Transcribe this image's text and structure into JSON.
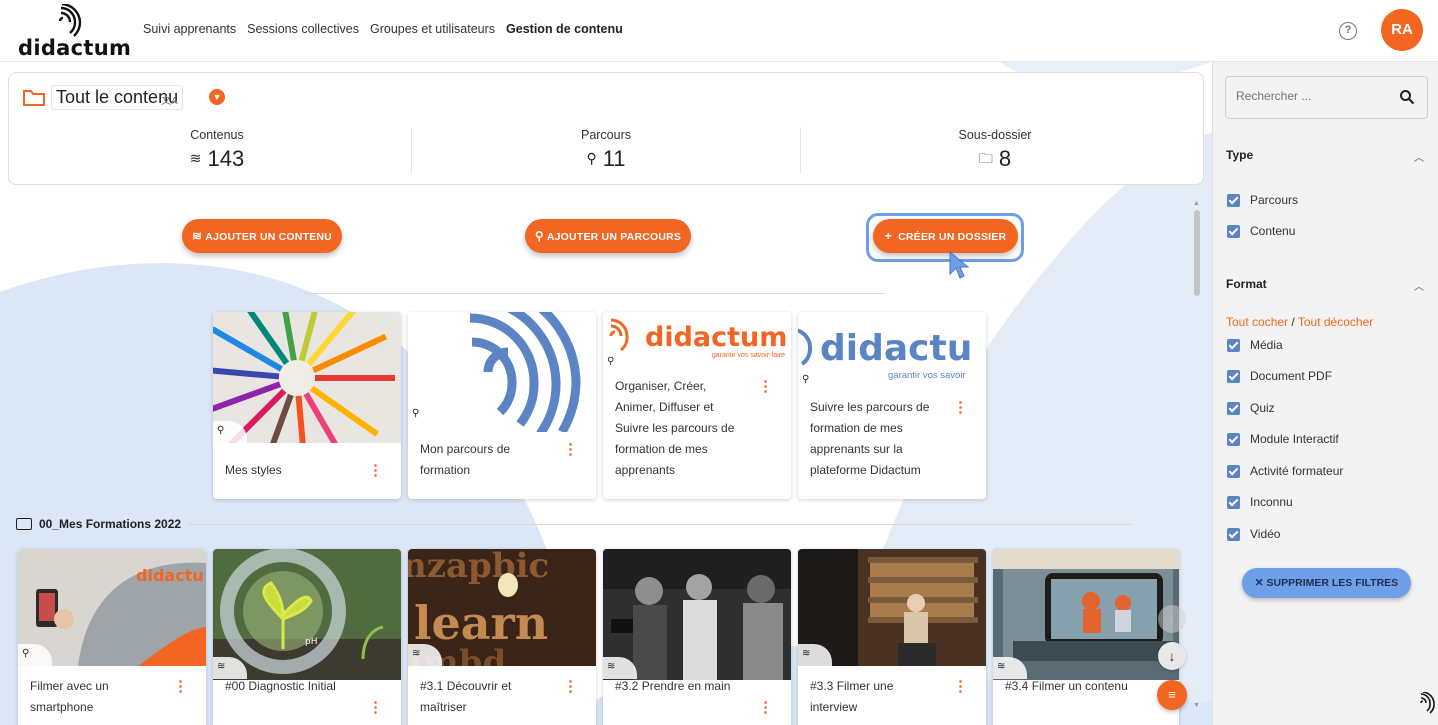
{
  "app": {
    "logo_text": "didactum"
  },
  "nav": {
    "items": [
      "Suivi apprenants",
      "Sessions collectives",
      "Groupes et utilisateurs",
      "Gestion de contenu"
    ],
    "active_index": 3
  },
  "header": {
    "help_icon": "help-circle-icon",
    "avatar_initials": "RA",
    "avatar_color": "#f26522"
  },
  "summary": {
    "title": "Tout le contenu",
    "translate_glyph": "文A",
    "stats": [
      {
        "label": "Contenus",
        "value": "143",
        "icon": "contenus-icon"
      },
      {
        "label": "Parcours",
        "value": "11",
        "icon": "parcours-icon"
      },
      {
        "label": "Sous-dossier",
        "value": "8",
        "icon": "folder-icon"
      }
    ]
  },
  "actions": {
    "add_content": "AJOUTER UN CONTENU",
    "add_path": "AJOUTER UN PARCOURS",
    "create_folder": "CRÉER UN DOSSIER",
    "create_folder_prefix": "+"
  },
  "parcours_cards": [
    {
      "title_lines": [
        "Mes styles"
      ],
      "image": "pencils"
    },
    {
      "title_lines": [
        "Mon parcours de",
        "formation"
      ],
      "image": "didactum-mark"
    },
    {
      "title_lines": [
        "Organiser, Créer,",
        "Animer, Diffuser et",
        "Suivre les parcours de",
        "formation de mes",
        "apprenants"
      ],
      "image": "didactum-logo-orange",
      "logo_word": "didactum",
      "logo_tagline": "garantir vos savoir-faire"
    },
    {
      "title_lines": [
        "Suivre les parcours de",
        "formation de mes",
        "apprenants sur la",
        "plateforme Didactum"
      ],
      "image": "didactum-logo-blue",
      "logo_word": "didactu",
      "logo_tagline": "garantir vos savoir"
    }
  ],
  "section": {
    "title": "00_Mes Formations 2022"
  },
  "content_cards": [
    {
      "title_lines": [
        "Filmer avec un",
        "smartphone"
      ],
      "image": "smartphone-filming",
      "overlay_word": "didactu"
    },
    {
      "title_lines": [
        "",
        "#00 Diagnostic Initial"
      ],
      "image": "plant-diagnostic",
      "overlay_word": "pH"
    },
    {
      "title_lines": [
        "#3.1 Découvrir et",
        "maîtriser"
      ],
      "image": "learn-letters"
    },
    {
      "title_lines": [
        "",
        "#3.2 Prendre en main"
      ],
      "image": "film-crew"
    },
    {
      "title_lines": [
        "#3.3 Filmer une",
        "interview"
      ],
      "image": "library-interview"
    },
    {
      "title_lines": [
        "",
        "#3.4 Filmer un contenu"
      ],
      "image": "phone-worksite"
    }
  ],
  "sidebar": {
    "search_placeholder": "Rechercher ...",
    "type_title": "Type",
    "type_options": [
      "Parcours",
      "Contenu"
    ],
    "format_title": "Format",
    "check_all": "Tout cocher",
    "separator": "/",
    "uncheck_all": "Tout décocher",
    "format_options": [
      "Média",
      "Document PDF",
      "Quiz",
      "Module Interactif",
      "Activité formateur",
      "Inconnu",
      "Vidéo"
    ],
    "clear_filters": "SUPPRIMER LES FILTRES"
  },
  "colors": {
    "accent": "#f26522",
    "blue": "#6f9fe8",
    "checkbox": "#5b84c4"
  }
}
